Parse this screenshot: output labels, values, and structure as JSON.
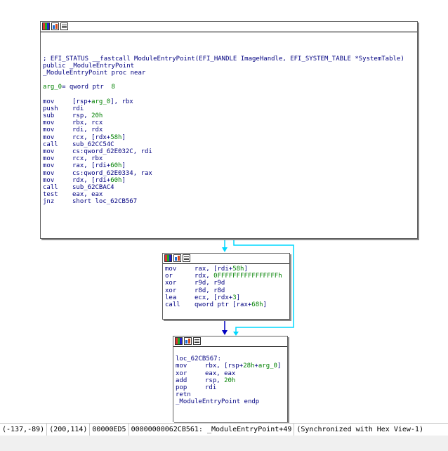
{
  "blocks": {
    "entry": {
      "lines": [
        {
          "kind": "blank"
        },
        {
          "kind": "blank"
        },
        {
          "kind": "blank"
        },
        {
          "kind": "comment",
          "text": "; EFI_STATUS __fastcall ModuleEntryPoint(EFI_HANDLE ImageHandle, EFI_SYSTEM_TABLE *SystemTable)"
        },
        {
          "kind": "text",
          "text": "public _ModuleEntryPoint"
        },
        {
          "kind": "text",
          "text": "_ModuleEntryPoint proc near"
        },
        {
          "kind": "blank"
        },
        {
          "kind": "arg",
          "name": "arg_0",
          "rest": "= qword ptr  8"
        },
        {
          "kind": "blank"
        },
        {
          "kind": "ins",
          "mn": "mov",
          "ops": "[rsp+arg_0], rbx"
        },
        {
          "kind": "ins",
          "mn": "push",
          "ops": "rdi"
        },
        {
          "kind": "ins",
          "mn": "sub",
          "ops": "rsp, 20h"
        },
        {
          "kind": "ins",
          "mn": "mov",
          "ops": "rbx, rcx"
        },
        {
          "kind": "ins",
          "mn": "mov",
          "ops": "rdi, rdx"
        },
        {
          "kind": "ins",
          "mn": "mov",
          "ops": "rcx, [rdx+58h]"
        },
        {
          "kind": "ins",
          "mn": "call",
          "ops": "sub_62CC54C"
        },
        {
          "kind": "ins",
          "mn": "mov",
          "ops": "cs:qword_62E032C, rdi"
        },
        {
          "kind": "ins",
          "mn": "mov",
          "ops": "rcx, rbx"
        },
        {
          "kind": "ins",
          "mn": "mov",
          "ops": "rax, [rdi+60h]"
        },
        {
          "kind": "ins",
          "mn": "mov",
          "ops": "cs:qword_62E0334, rax"
        },
        {
          "kind": "ins",
          "mn": "mov",
          "ops": "rdx, [rdi+60h]"
        },
        {
          "kind": "ins",
          "mn": "call",
          "ops": "sub_62CBAC4"
        },
        {
          "kind": "ins",
          "mn": "test",
          "ops": "eax, eax"
        },
        {
          "kind": "ins",
          "mn": "jnz",
          "ops": "short loc_62CB567"
        }
      ]
    },
    "middle": {
      "lines": [
        {
          "kind": "ins",
          "mn": "mov",
          "ops": "rax, [rdi+58h]"
        },
        {
          "kind": "ins",
          "mn": "or",
          "ops": "rdx, 0FFFFFFFFFFFFFFFFh"
        },
        {
          "kind": "ins",
          "mn": "xor",
          "ops": "r9d, r9d"
        },
        {
          "kind": "ins",
          "mn": "xor",
          "ops": "r8d, r8d"
        },
        {
          "kind": "ins",
          "mn": "lea",
          "ops": "ecx, [rdx+3]"
        },
        {
          "kind": "ins",
          "mn": "call",
          "ops": "qword ptr [rax+68h]"
        }
      ]
    },
    "exit": {
      "lines": [
        {
          "kind": "blank"
        },
        {
          "kind": "label",
          "text": "loc_62CB567:"
        },
        {
          "kind": "ins",
          "mn": "mov",
          "ops": "rbx, [rsp+28h+arg_0]"
        },
        {
          "kind": "ins",
          "mn": "xor",
          "ops": "eax, eax"
        },
        {
          "kind": "ins",
          "mn": "add",
          "ops": "rsp, 20h"
        },
        {
          "kind": "ins",
          "mn": "pop",
          "ops": "rdi"
        },
        {
          "kind": "ins",
          "mn": "retn",
          "ops": ""
        },
        {
          "kind": "text",
          "text": "_ModuleEntryPoint endp"
        }
      ]
    }
  },
  "status_bar": {
    "cells": [
      "(-137,-89)",
      "(200,114)",
      "00000ED5",
      "00000000062CB561: _ModuleEntryPoint+49",
      "(Synchronized with Hex View-1)"
    ]
  },
  "colors": {
    "edge_taken": "#00d8ff",
    "edge_normal": "#0000c0",
    "code": "#000080",
    "number": "#008000"
  }
}
